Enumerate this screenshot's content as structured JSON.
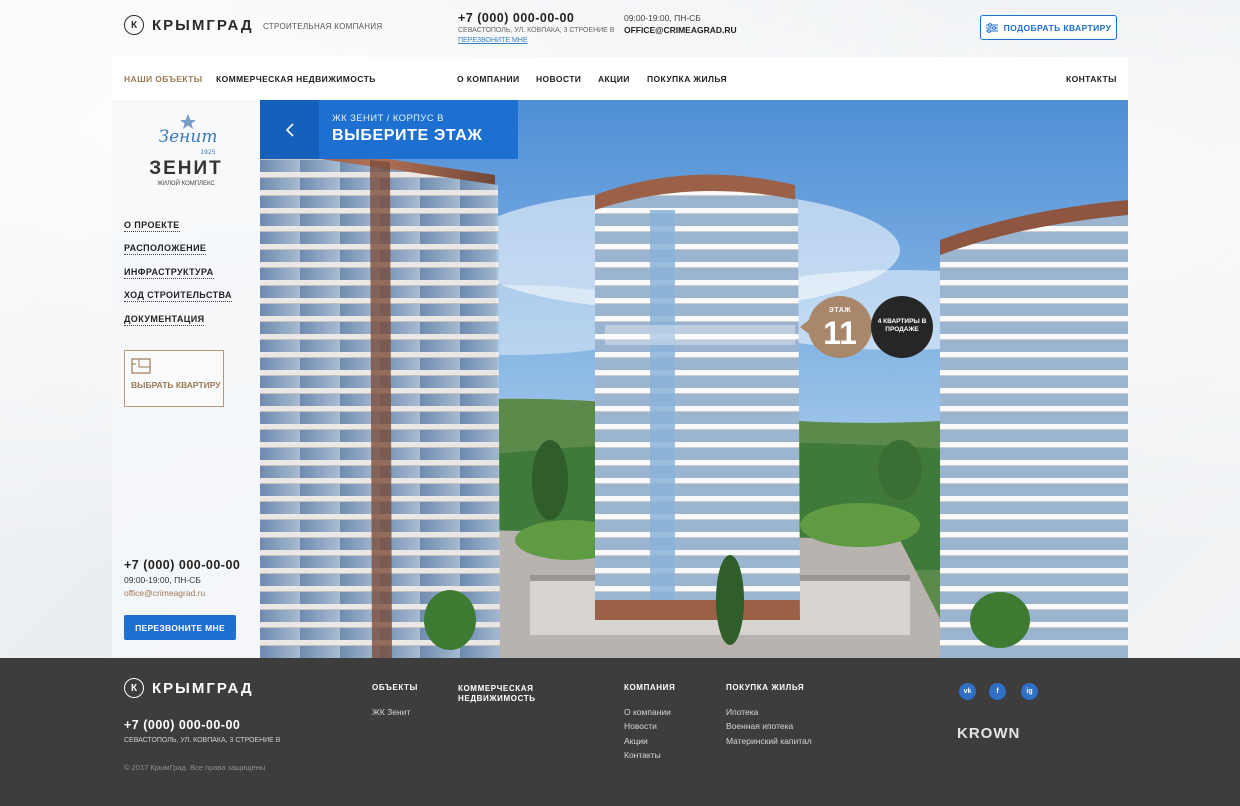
{
  "brand": {
    "name": "КРЫМГРАД",
    "tagline": "СТРОИТЕЛЬНАЯ КОМПАНИЯ",
    "mark": "К"
  },
  "contacts": {
    "phone": "+7 (000) 000-00-00",
    "address": "СЕВАСТОПОЛЬ, УЛ. КОВПАКА, 3 СТРОЕНИЕ В",
    "callback_link": "ПЕРЕЗВОНИТЕ МНЕ",
    "hours": "09:00-19:00, ПН-СБ",
    "email": "OFFICE@CRIMEAGRAD.RU"
  },
  "pick_button": "ПОДОБРАТЬ КВАРТИРУ",
  "nav": [
    {
      "label": "НАШИ ОБЪЕКТЫ",
      "active": true
    },
    {
      "label": "КОММЕРЧЕСКАЯ НЕДВИЖИМОСТЬ"
    },
    {
      "label": "О КОМПАНИИ"
    },
    {
      "label": "НОВОСТИ"
    },
    {
      "label": "АКЦИИ"
    },
    {
      "label": "ПОКУПКА ЖИЛЬЯ"
    },
    {
      "label": "КОНТАКТЫ"
    }
  ],
  "complex": {
    "logo_word": "Зенит",
    "logo_year": "1925",
    "title": "ЗЕНИТ",
    "subtitle": "жилой комплекс"
  },
  "sidebar": {
    "links": [
      "О ПРОЕКТЕ",
      "РАСПОЛОЖЕНИЕ",
      "ИНФРАСТРУКТУРА",
      "ХОД СТРОИТЕЛЬСТВА",
      "ДОКУМЕНТАЦИЯ"
    ],
    "choose_button": "ВЫБРАТЬ КВАРТИРУ",
    "phone": "+7 (000) 000-00-00",
    "hours": "09:00-19:00, ПН-СБ",
    "email": "office@crimeagrad.ru",
    "callback_button": "ПЕРЕЗВОНИТЕ МНЕ"
  },
  "hero": {
    "breadcrumb": "ЖК ЗЕНИТ / КОРПУС В",
    "title": "ВЫБЕРИТЕ ЭТАЖ",
    "floor_label": "ЭТАЖ",
    "floor_number": "11",
    "sale_text": "4 КВАРТИРЫ В ПРОДАЖЕ"
  },
  "footer": {
    "phone": "+7 (000) 000-00-00",
    "address": "СЕВАСТОПОЛЬ, УЛ. КОВПАКА, 3 СТРОЕНИЕ В",
    "copyright": "© 2017 КрымГрад. Все права защищены",
    "col_objects": {
      "heading": "ОБЪЕКТЫ",
      "links": [
        "ЖК Зенит"
      ]
    },
    "col_commercial": {
      "heading_line1": "КОММЕРЧЕСКАЯ",
      "heading_line2": "НЕДВИЖИМОСТЬ"
    },
    "col_company": {
      "heading": "КОМПАНИЯ",
      "links": [
        "О компании",
        "Новости",
        "Акции",
        "Контакты"
      ]
    },
    "col_buying": {
      "heading": "ПОКУПКА ЖИЛЬЯ",
      "links": [
        "Ипотека",
        "Военная ипотека",
        "Материнский капитал"
      ]
    },
    "social": [
      "vk-icon",
      "facebook-icon",
      "instagram-icon"
    ],
    "social_glyphs": [
      "vk",
      "f",
      "ig"
    ],
    "partner": "KROWN"
  },
  "colors": {
    "accent": "#1d6fd0",
    "gold": "#a9876a",
    "footer_bg": "#3d3d3d"
  }
}
